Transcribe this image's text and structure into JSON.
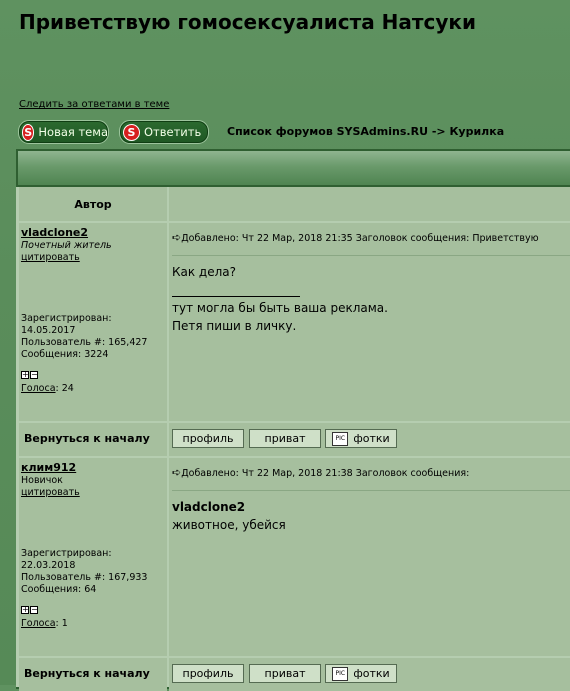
{
  "page": {
    "title": "Приветствую гомосексуалиста Натсуки",
    "watch_link": "Следить за ответами в теме",
    "new_topic_label": "Новая тема",
    "reply_label": "Ответить",
    "breadcrumb": "Список форумов SYSAdmins.RU -> Курилка"
  },
  "table": {
    "author_header": "Автор"
  },
  "posts": [
    {
      "username": "vladclone2",
      "rank": "Почетный житель",
      "quote_link": "цитировать",
      "registered_label": "Зарегистрирован:",
      "registered_date": "14.05.2017",
      "user_num": "Пользователь #: 165,427",
      "messages": "Сообщения: 3224",
      "votes_label": "Голоса",
      "votes_value": ": 24",
      "header": "Добавлено: Чт 22 Мар, 2018 21:35    Заголовок сообщения: Приветствую",
      "line1": "Как дела?",
      "line2": "тут могла бы быть ваша реклама.",
      "line3": "Петя пиши в личку."
    },
    {
      "username": "клим912",
      "rank": "Новичок",
      "quote_link": "цитировать",
      "registered_label": "Зарегистрирован:",
      "registered_date": "22.03.2018",
      "user_num": "Пользователь #: 167,933",
      "messages": "Сообщения: 64",
      "votes_label": "Голоса",
      "votes_value": ": 1",
      "header": "Добавлено: Чт 22 Мар, 2018 21:38    Заголовок сообщения:",
      "quoted_user": "vladclone2",
      "text": "животное, убейся"
    }
  ],
  "footer": {
    "back_to_top": "Вернуться к началу",
    "profile": "профиль",
    "private": "приват",
    "photos": "фотки"
  }
}
